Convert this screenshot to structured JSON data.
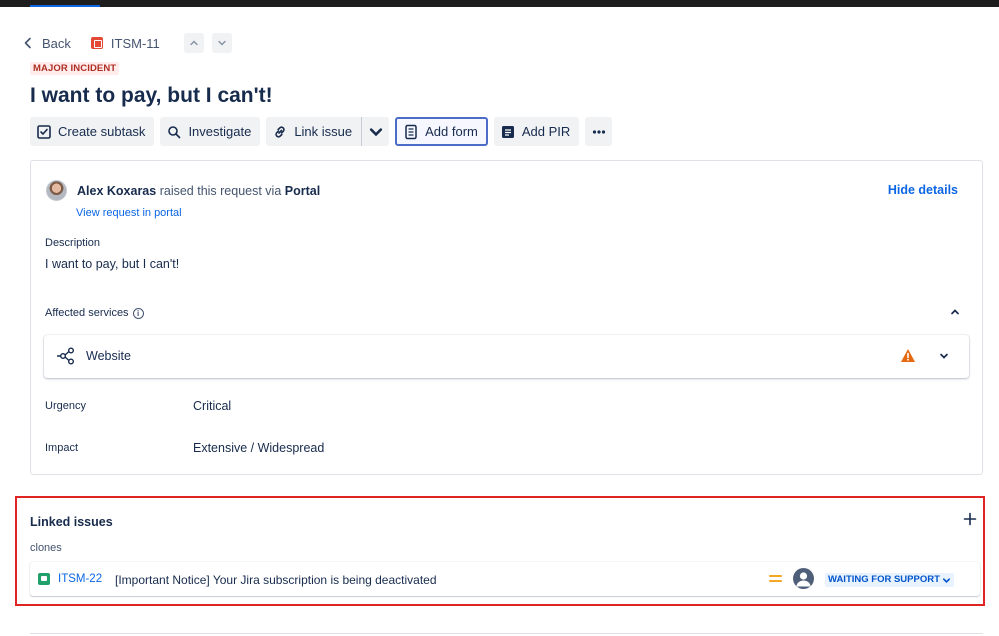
{
  "nav": {
    "back_label": "Back",
    "issue_key": "ITSM-11"
  },
  "issue": {
    "badge": "MAJOR INCIDENT",
    "title": "I want to pay, but I can't!"
  },
  "toolbar": {
    "create_subtask": "Create subtask",
    "investigate": "Investigate",
    "link_issue": "Link issue",
    "add_form": "Add form",
    "add_pir": "Add PIR"
  },
  "details": {
    "reporter_name": "Alex Koxaras",
    "raised_text": "raised this request via",
    "channel": "Portal",
    "view_request": "View request in portal",
    "hide_details": "Hide details",
    "description_label": "Description",
    "description_text": "I want to pay, but I can't!",
    "affected_services_label": "Affected services",
    "service_name": "Website",
    "urgency_label": "Urgency",
    "urgency_value": "Critical",
    "impact_label": "Impact",
    "impact_value": "Extensive / Widespread"
  },
  "linked_issues": {
    "title": "Linked issues",
    "link_type": "clones",
    "items": [
      {
        "key": "ITSM-22",
        "summary": "[Important Notice] Your Jira subscription is being deactivated",
        "status": "WAITING FOR SUPPORT"
      }
    ]
  },
  "colors": {
    "accent": "#0c66e4",
    "major_incident_bg": "#ffeceb",
    "major_incident_text": "#ae2e24",
    "highlight_border": "#e02424",
    "priority_medium": "#f5a623",
    "warning": "#e56910"
  }
}
